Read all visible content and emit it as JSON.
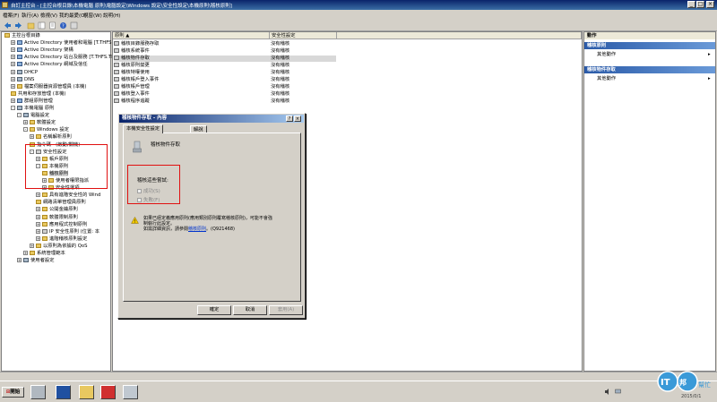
{
  "window": {
    "title": "自訂主控台 - [主控台根目錄\\本機電腦 原則\\電腦設定\\Windows 設定\\安全性設定\\本機原則\\稽核原則]",
    "minimize": "_",
    "maximize": "□",
    "close": "×"
  },
  "menu": [
    "檔案(F)",
    "執行(A)",
    "檢視(V)",
    "我的最愛(O)",
    "視窗(W)",
    "說明(H)"
  ],
  "tree": [
    {
      "label": "主控台根目錄",
      "indent": 0,
      "icon": "folder",
      "exp": ""
    },
    {
      "label": "Active Directory 使用者和電腦 [T.THFS.TH",
      "indent": 1,
      "icon": "book",
      "exp": "+"
    },
    {
      "label": "Active Directory 架構",
      "indent": 1,
      "icon": "book",
      "exp": "+"
    },
    {
      "label": "Active Directory 站台及服務 [T.THFS.TH",
      "indent": 1,
      "icon": "book",
      "exp": "+"
    },
    {
      "label": "Active Directory 網域及信任",
      "indent": 1,
      "icon": "book",
      "exp": "+"
    },
    {
      "label": "DHCP",
      "indent": 1,
      "icon": "comp",
      "exp": "+"
    },
    {
      "label": "DNS",
      "indent": 1,
      "icon": "comp",
      "exp": "+"
    },
    {
      "label": "檔案伺服器資源管理員 (本機)",
      "indent": 1,
      "icon": "folder",
      "exp": "+"
    },
    {
      "label": "共用和存放管理 (本機)",
      "indent": 1,
      "icon": "folder",
      "exp": ""
    },
    {
      "label": "群組原則管理",
      "indent": 1,
      "icon": "book",
      "exp": "+"
    },
    {
      "label": "本機電腦 原則",
      "indent": 1,
      "icon": "comp",
      "exp": "-"
    },
    {
      "label": "電腦設定",
      "indent": 2,
      "icon": "comp",
      "exp": "-"
    },
    {
      "label": "軟體設定",
      "indent": 3,
      "icon": "folder",
      "exp": "+"
    },
    {
      "label": "Windows 設定",
      "indent": 3,
      "icon": "folder",
      "exp": "-"
    },
    {
      "label": "名稱解析原則",
      "indent": 4,
      "icon": "folder",
      "exp": "+"
    },
    {
      "label": "指令碼 - (啟動/關機)",
      "indent": 4,
      "icon": "folder",
      "exp": ""
    },
    {
      "label": "安全性設定",
      "indent": 4,
      "icon": "lock",
      "exp": "-"
    },
    {
      "label": "帳戶原則",
      "indent": 5,
      "icon": "folder",
      "exp": "+"
    },
    {
      "label": "本機原則",
      "indent": 5,
      "icon": "folder",
      "exp": "-"
    },
    {
      "label": "稽核原則",
      "indent": 6,
      "icon": "folder",
      "exp": "",
      "selected": true
    },
    {
      "label": "使用者權限指派",
      "indent": 6,
      "icon": "folder",
      "exp": "+"
    },
    {
      "label": "安全性選項",
      "indent": 6,
      "icon": "folder",
      "exp": "+"
    },
    {
      "label": "具有進階安全性的 Wind",
      "indent": 5,
      "icon": "folder",
      "exp": "+"
    },
    {
      "label": "網路清單管理員原則",
      "indent": 5,
      "icon": "folder",
      "exp": ""
    },
    {
      "label": "公開金鑰原則",
      "indent": 5,
      "icon": "folder",
      "exp": "+"
    },
    {
      "label": "軟體限制原則",
      "indent": 5,
      "icon": "folder",
      "exp": "+"
    },
    {
      "label": "應用程式控制原則",
      "indent": 5,
      "icon": "folder",
      "exp": "+"
    },
    {
      "label": "IP 安全性原則 (位置: 本",
      "indent": 5,
      "icon": "lock",
      "exp": "+"
    },
    {
      "label": "進階稽核原則設定",
      "indent": 5,
      "icon": "folder",
      "exp": "+"
    },
    {
      "label": "以原則為依據的 QoS",
      "indent": 4,
      "icon": "folder",
      "exp": "+"
    },
    {
      "label": "系統管理範本",
      "indent": 3,
      "icon": "folder",
      "exp": "+"
    },
    {
      "label": "使用者設定",
      "indent": 2,
      "icon": "comp",
      "exp": "+"
    }
  ],
  "list": {
    "col_policy": "原則 ▲",
    "col_setting": "安全性設定",
    "rows": [
      {
        "policy": "稽核目錄服務存取",
        "setting": "沒有稽核"
      },
      {
        "policy": "稽核系統事件",
        "setting": "沒有稽核"
      },
      {
        "policy": "稽核物件存取",
        "setting": "沒有稽核",
        "selected": true
      },
      {
        "policy": "稽核原則變更",
        "setting": "沒有稽核"
      },
      {
        "policy": "稽核特權使用",
        "setting": "沒有稽核"
      },
      {
        "policy": "稽核帳戶登入事件",
        "setting": "沒有稽核"
      },
      {
        "policy": "稽核帳戶管理",
        "setting": "沒有稽核"
      },
      {
        "policy": "稽核登入事件",
        "setting": "沒有稽核"
      },
      {
        "policy": "稽核程序追蹤",
        "setting": "沒有稽核"
      }
    ]
  },
  "actions": {
    "header": "動作",
    "group1": "稽核原則",
    "group1_item": "其他動作",
    "group2": "稽核物件存取",
    "group2_item": "其他動作"
  },
  "dialog": {
    "title": "稽核物件存取 - 內容",
    "help": "?",
    "close": "×",
    "tab_active": "本機安全性設定",
    "tab_other": "解說",
    "policy_name": "稽核物件存取",
    "audit_label": "稽核這些嘗試:",
    "success": "成功(S)",
    "failure": "失敗(F)",
    "warning_line1": "如果已經定義應用原則(應用類別原則覆寫稽核原則)，可能不會強",
    "warning_line2": "制執行此設定。",
    "more_info_prefix": "如需詳細資訊，請參閱",
    "more_info_link": "稽核原則",
    "more_info_suffix": "。(Q921468)",
    "ok": "確定",
    "cancel": "取消",
    "apply": "套用(A)"
  },
  "taskbar": {
    "start": "開始",
    "date": "2015/0/1"
  },
  "watermark": {
    "brand_left": "IT",
    "brand_right": "幫忙"
  }
}
